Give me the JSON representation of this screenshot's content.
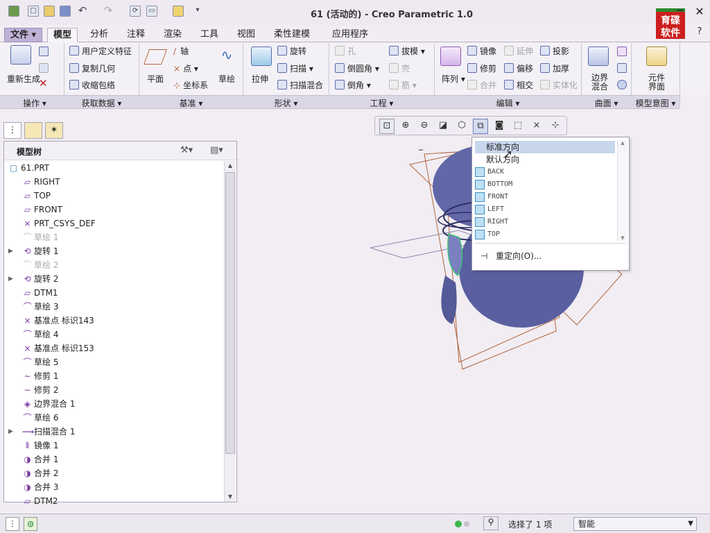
{
  "window": {
    "title": "61 (活动的) - Creo Parametric 1.0",
    "logo_text": "育碟\n软件",
    "minimize": "−",
    "maximize": "□",
    "close": "✕"
  },
  "tabs": [
    {
      "label": "文件 ▾"
    },
    {
      "label": "模型"
    },
    {
      "label": "分析"
    },
    {
      "label": "注释"
    },
    {
      "label": "渲染"
    },
    {
      "label": "工具"
    },
    {
      "label": "视图"
    },
    {
      "label": "柔性建模"
    },
    {
      "label": "应用程序"
    }
  ],
  "ribbon": {
    "regenerate": "重新生成",
    "user_feature": "用户定义特征",
    "copy_geometry": "复制几何",
    "shrinkwrap": "收缩包络",
    "plane": "平面",
    "axis": "轴",
    "point": "点",
    "csys": "坐标系",
    "sketch": "草绘",
    "extrude": "拉伸",
    "revolve": "旋转",
    "sweep": "扫描",
    "swept_blend": "扫描混合",
    "hole": "孔",
    "round": "倒圆角",
    "chamfer": "倒角",
    "draft": "拔模",
    "shell": "壳",
    "rib": "筋",
    "pattern": "阵列",
    "mirror": "镜像",
    "trim": "修剪",
    "merge": "合并",
    "extend": "延伸",
    "offset": "偏移",
    "intersect": "相交",
    "project": "投影",
    "thicken": "加厚",
    "solidify": "实体化",
    "boundary_blend": "边界混合",
    "component_interface": "元件界面"
  },
  "groups": {
    "operations": "操作 ▾",
    "get_data": "获取数据 ▾",
    "datum": "基准 ▾",
    "shapes": "形状 ▾",
    "engineering": "工程 ▾",
    "editing": "编辑 ▾",
    "surfaces": "曲面 ▾",
    "model_intent": "模型意图 ▾"
  },
  "model_tree": {
    "title": "模型树",
    "items": [
      {
        "label": "61.PRT",
        "icon": "part-icon",
        "expand": false,
        "dim": false
      },
      {
        "label": "RIGHT",
        "icon": "datum-plane-icon",
        "expand": false,
        "dim": false
      },
      {
        "label": "TOP",
        "icon": "datum-plane-icon",
        "expand": false,
        "dim": false
      },
      {
        "label": "FRONT",
        "icon": "datum-plane-icon",
        "expand": false,
        "dim": false
      },
      {
        "label": "PRT_CSYS_DEF",
        "icon": "csys-icon",
        "expand": false,
        "dim": false
      },
      {
        "label": "草绘 1",
        "icon": "sketch-icon",
        "expand": false,
        "dim": true
      },
      {
        "label": "旋转 1",
        "icon": "revolve-icon",
        "expand": true,
        "dim": false
      },
      {
        "label": "草绘 2",
        "icon": "sketch-icon",
        "expand": false,
        "dim": true
      },
      {
        "label": "旋转 2",
        "icon": "revolve-icon",
        "expand": true,
        "dim": false
      },
      {
        "label": "DTM1",
        "icon": "datum-plane-icon",
        "expand": false,
        "dim": false
      },
      {
        "label": "草绘 3",
        "icon": "sketch-icon",
        "expand": false,
        "dim": false
      },
      {
        "label": "基准点 标识143",
        "icon": "datum-point-icon",
        "expand": false,
        "dim": false
      },
      {
        "label": "草绘 4",
        "icon": "sketch-icon",
        "expand": false,
        "dim": false
      },
      {
        "label": "基准点 标识153",
        "icon": "datum-point-icon",
        "expand": false,
        "dim": false
      },
      {
        "label": "草绘 5",
        "icon": "sketch-icon",
        "expand": false,
        "dim": false
      },
      {
        "label": "修剪 1",
        "icon": "trim-icon",
        "expand": false,
        "dim": false
      },
      {
        "label": "修剪 2",
        "icon": "trim-icon",
        "expand": false,
        "dim": false
      },
      {
        "label": "边界混合 1",
        "icon": "boundary-blend-icon",
        "expand": false,
        "dim": false
      },
      {
        "label": "草绘 6",
        "icon": "sketch-icon",
        "expand": false,
        "dim": false
      },
      {
        "label": "扫描混合 1",
        "icon": "swept-blend-icon",
        "expand": true,
        "dim": false
      },
      {
        "label": "镜像 1",
        "icon": "mirror-icon",
        "expand": false,
        "dim": false
      },
      {
        "label": "合并 1",
        "icon": "merge-icon",
        "expand": false,
        "dim": false
      },
      {
        "label": "合并 2",
        "icon": "merge-icon",
        "expand": false,
        "dim": false
      },
      {
        "label": "合并 3",
        "icon": "merge-icon",
        "expand": false,
        "dim": false
      },
      {
        "label": "DTM2",
        "icon": "datum-plane-icon",
        "expand": false,
        "dim": false
      }
    ]
  },
  "view_menu": {
    "items": [
      {
        "label": "标准方向",
        "selected": true,
        "cube": false
      },
      {
        "label": "默认方向",
        "selected": false,
        "cube": false
      },
      {
        "label": "BACK",
        "selected": false,
        "cube": true
      },
      {
        "label": "BOTTOM",
        "selected": false,
        "cube": true
      },
      {
        "label": "FRONT",
        "selected": false,
        "cube": true
      },
      {
        "label": "LEFT",
        "selected": false,
        "cube": true
      },
      {
        "label": "RIGHT",
        "selected": false,
        "cube": true
      },
      {
        "label": "TOP",
        "selected": false,
        "cube": true
      }
    ],
    "reorient": "重定向(O)..."
  },
  "status": {
    "selection": "选择了 1 项",
    "filter": "智能"
  },
  "colors": {
    "model": "#5a5fa0",
    "datum_planes": "#b0643c",
    "highlight": "#c8d6ec"
  }
}
